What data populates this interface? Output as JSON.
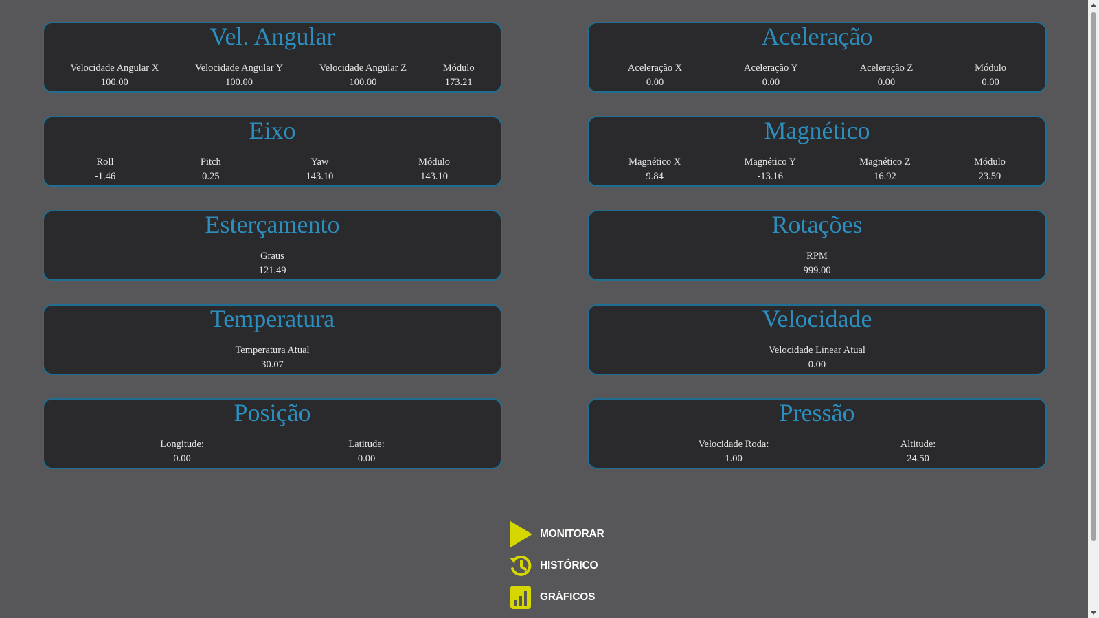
{
  "cards": {
    "vel_angular": {
      "title": "Vel. Angular",
      "fields": [
        {
          "label": "Velocidade Angular X",
          "value": "100.00"
        },
        {
          "label": "Velocidade Angular Y",
          "value": "100.00"
        },
        {
          "label": "Velocidade Angular Z",
          "value": "100.00"
        },
        {
          "label": "Módulo",
          "value": "173.21"
        }
      ]
    },
    "aceleracao": {
      "title": "Aceleração",
      "fields": [
        {
          "label": "Aceleração X",
          "value": "0.00"
        },
        {
          "label": "Aceleração Y",
          "value": "0.00"
        },
        {
          "label": "Aceleração Z",
          "value": "0.00"
        },
        {
          "label": "Módulo",
          "value": "0.00"
        }
      ]
    },
    "eixo": {
      "title": "Eixo",
      "fields": [
        {
          "label": "Roll",
          "value": "-1.46"
        },
        {
          "label": "Pitch",
          "value": "0.25"
        },
        {
          "label": "Yaw",
          "value": "143.10"
        },
        {
          "label": "Módulo",
          "value": "143.10"
        }
      ]
    },
    "magnetico": {
      "title": "Magnético",
      "fields": [
        {
          "label": "Magnético X",
          "value": "9.84"
        },
        {
          "label": "Magnético Y",
          "value": "-13.16"
        },
        {
          "label": "Magnético Z",
          "value": "16.92"
        },
        {
          "label": "Módulo",
          "value": "23.59"
        }
      ]
    },
    "estercamento": {
      "title": "Esterçamento",
      "fields": [
        {
          "label": "Graus",
          "value": "121.49"
        }
      ]
    },
    "rotacoes": {
      "title": "Rotações",
      "fields": [
        {
          "label": "RPM",
          "value": "999.00"
        }
      ]
    },
    "temperatura": {
      "title": "Temperatura",
      "fields": [
        {
          "label": "Temperatura Atual",
          "value": "30.07"
        }
      ]
    },
    "velocidade": {
      "title": "Velocidade",
      "fields": [
        {
          "label": "Velocidade Linear Atual",
          "value": "0.00"
        }
      ]
    },
    "posicao": {
      "title": "Posição",
      "fields": [
        {
          "label": "Longitude:",
          "value": "0.00"
        },
        {
          "label": "Latitude:",
          "value": "0.00"
        }
      ]
    },
    "pressao": {
      "title": "Pressão",
      "fields": [
        {
          "label": "Velocidade Roda:",
          "value": "1.00"
        },
        {
          "label": "Altitude:",
          "value": "24.50"
        }
      ]
    }
  },
  "menu": {
    "items": [
      {
        "label": "MONITORAR",
        "icon": "play-icon"
      },
      {
        "label": "HISTÓRICO",
        "icon": "history-icon"
      },
      {
        "label": "GRÁFICOS",
        "icon": "bar-chart-icon"
      }
    ]
  },
  "colors": {
    "background": "#57575a",
    "card_background": "#2a2a2c",
    "card_border": "#1e6f93",
    "title": "#2b8fc0",
    "icon_yellow": "#d6d600"
  }
}
